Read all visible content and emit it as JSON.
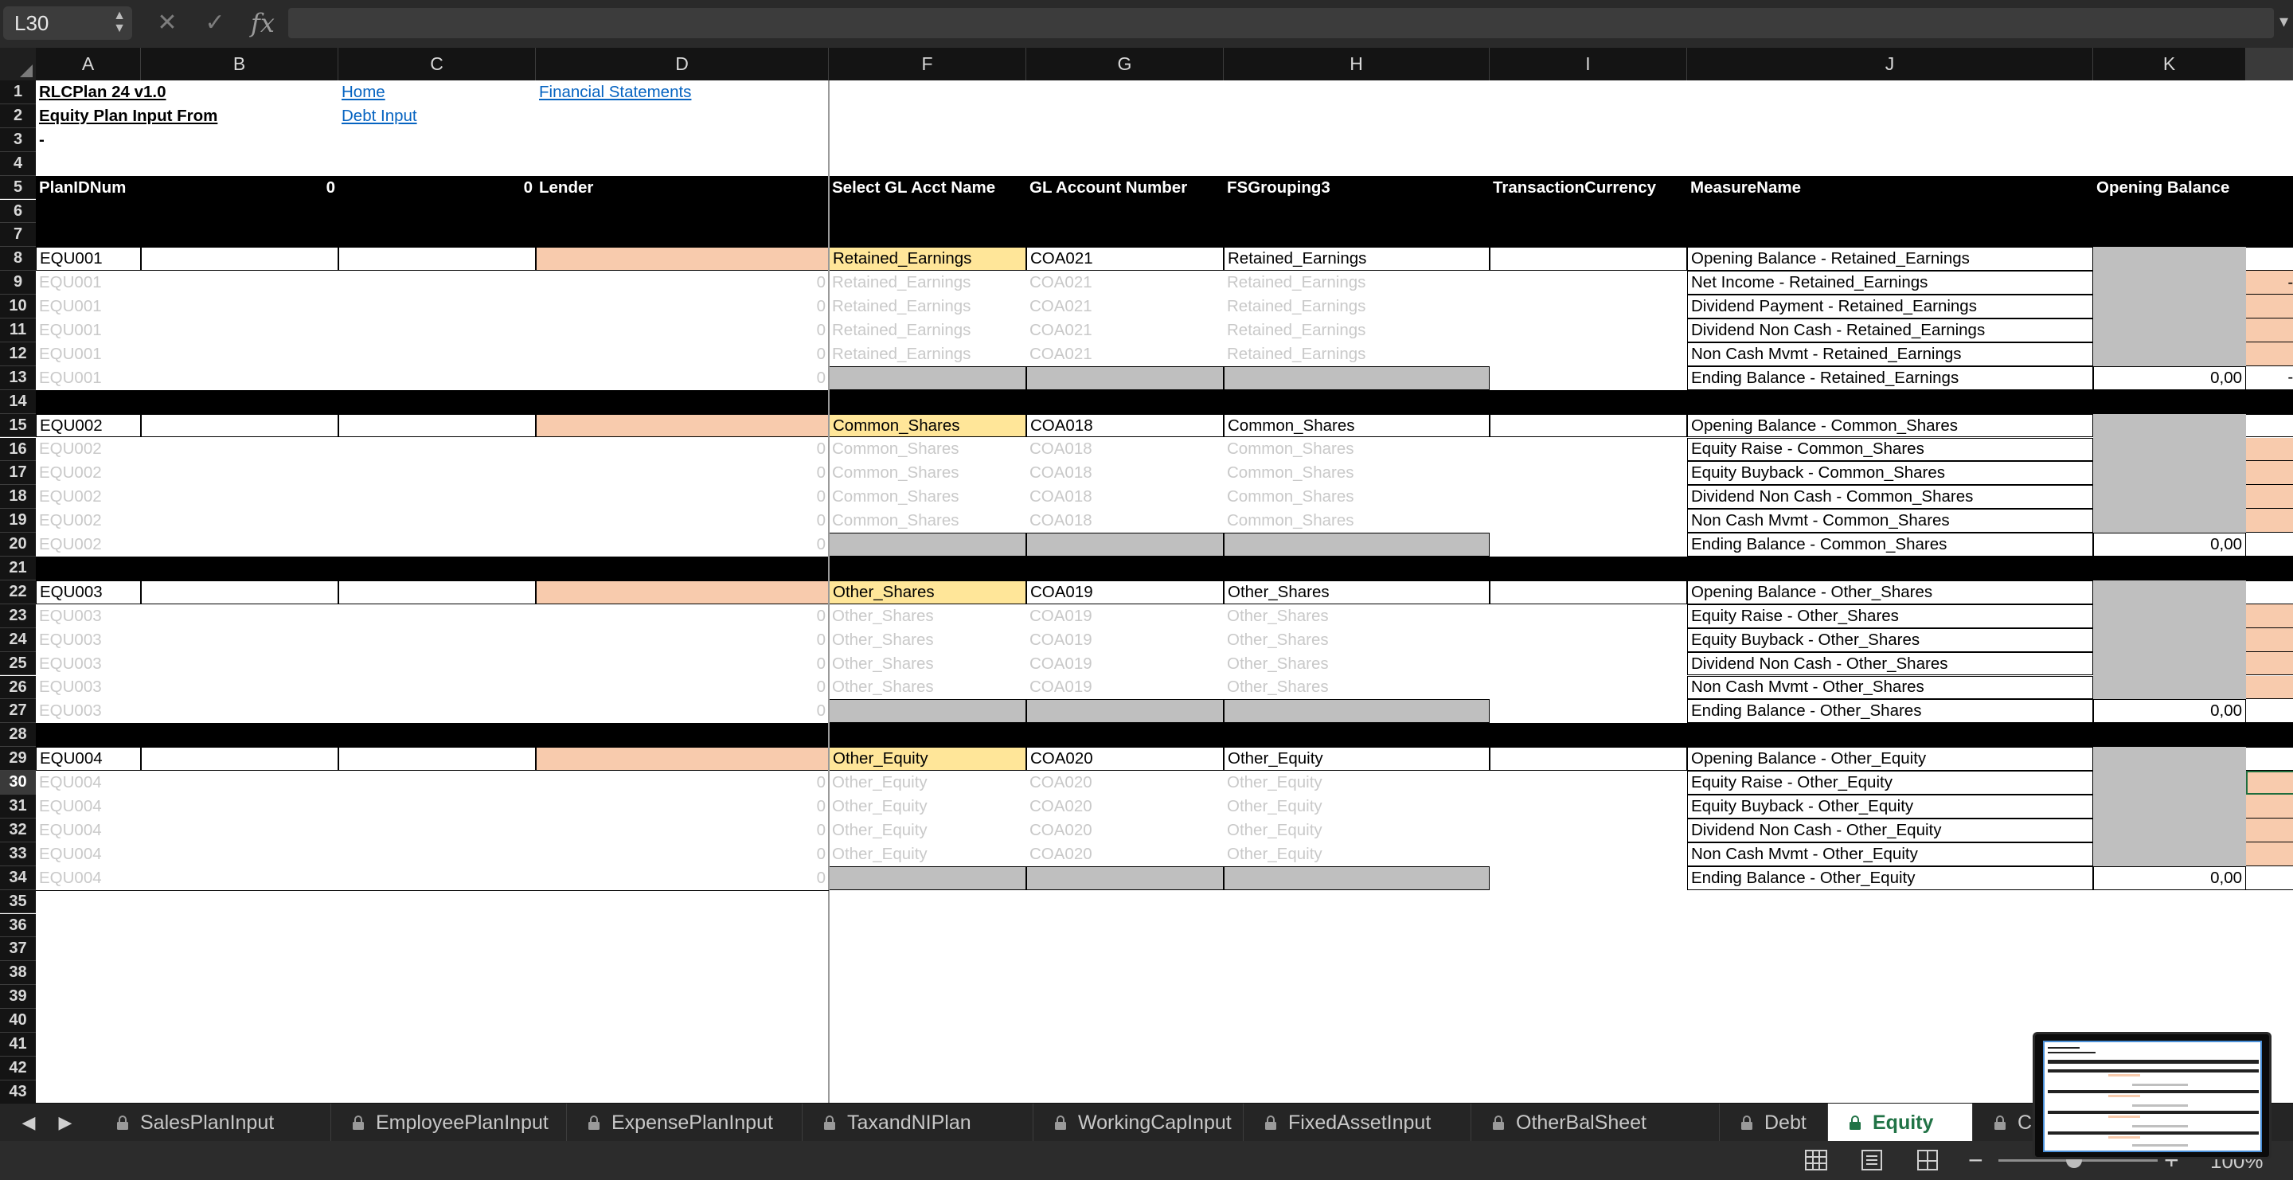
{
  "formula_bar": {
    "name_box": "L30",
    "cancel_icon": "close-icon",
    "enter_icon": "check-icon",
    "fx_label": "fx",
    "formula_value": ""
  },
  "columns": [
    "A",
    "B",
    "C",
    "D",
    "F",
    "G",
    "H",
    "I",
    "J",
    "K"
  ],
  "rows": [
    "1",
    "2",
    "3",
    "4",
    "5",
    "6",
    "7",
    "8",
    "9",
    "10",
    "11",
    "12",
    "13",
    "14",
    "15",
    "16",
    "17",
    "18",
    "19",
    "20",
    "21",
    "22",
    "23",
    "24",
    "25",
    "26",
    "27",
    "28",
    "29",
    "30",
    "31",
    "32",
    "33",
    "34",
    "35",
    "36",
    "37",
    "38",
    "39",
    "40",
    "41",
    "42",
    "43"
  ],
  "selected_cell": "L30",
  "top": {
    "title": "RLCPlan 24 v1.0",
    "subtitle": "Equity Plan Input From",
    "dash": "-",
    "link_home": "Home",
    "link_financials": "Financial Statements",
    "link_debt": "Debt Input"
  },
  "header_row": {
    "plan_id": "PlanIDNum",
    "b_value": "0",
    "c_value": "0",
    "lender": "Lender",
    "gl_name": "Select GL Acct Name",
    "gl_number": "GL Account Number",
    "fs_grouping": "FSGrouping3",
    "currency": "TransactionCurrency",
    "measure": "MeasureName",
    "opening": "Opening Balance"
  },
  "blocks": [
    {
      "id": "EQU001",
      "gl_name": "Retained_Earnings",
      "gl_number": "COA021",
      "fs_group": "Retained_Earnings",
      "ghost_value": "0",
      "measures": [
        "Opening Balance - Retained_Earnings",
        "Net Income - Retained_Earnings",
        "Dividend Payment - Retained_Earnings",
        "Dividend Non Cash - Retained_Earnings",
        "Non Cash Mvmt - Retained_Earnings",
        "Ending Balance - Retained_Earnings"
      ],
      "ending_value": "0,00",
      "l_partial": [
        "",
        "-(",
        "",
        "",
        "",
        "-("
      ]
    },
    {
      "id": "EQU002",
      "gl_name": "Common_Shares",
      "gl_number": "COA018",
      "fs_group": "Common_Shares",
      "ghost_value": "0",
      "measures": [
        "Opening Balance - Common_Shares",
        "Equity Raise - Common_Shares",
        "Equity Buyback - Common_Shares",
        "Dividend Non Cash - Common_Shares",
        "Non Cash Mvmt - Common_Shares",
        "Ending Balance - Common_Shares"
      ],
      "ending_value": "0,00",
      "l_partial": [
        "",
        "",
        "",
        "",
        "",
        ""
      ]
    },
    {
      "id": "EQU003",
      "gl_name": "Other_Shares",
      "gl_number": "COA019",
      "fs_group": "Other_Shares",
      "ghost_value": "0",
      "measures": [
        "Opening Balance - Other_Shares",
        "Equity Raise - Other_Shares",
        "Equity Buyback - Other_Shares",
        "Dividend Non Cash - Other_Shares",
        "Non Cash Mvmt - Other_Shares",
        "Ending Balance - Other_Shares"
      ],
      "ending_value": "0,00",
      "l_partial": [
        "",
        "",
        "",
        "",
        "",
        ""
      ]
    },
    {
      "id": "EQU004",
      "gl_name": "Other_Equity",
      "gl_number": "COA020",
      "fs_group": "Other_Equity",
      "ghost_value": "0",
      "measures": [
        "Opening Balance - Other_Equity",
        "Equity Raise - Other_Equity",
        "Equity Buyback - Other_Equity",
        "Dividend Non Cash - Other_Equity",
        "Non Cash Mvmt - Other_Equity",
        "Ending Balance - Other_Equity"
      ],
      "ending_value": "0,00",
      "l_partial": [
        "",
        "",
        "",
        "",
        "",
        ""
      ]
    }
  ],
  "tabs": [
    "SalesPlanInput",
    "EmployeePlanInput",
    "ExpensePlanInput",
    "TaxandNIPlan",
    "WorkingCapInput",
    "FixedAssetInput",
    "OtherBalSheet",
    "Debt",
    "Equity",
    "C"
  ],
  "active_tab": "Equity",
  "tab_icons": {
    "lock": "lock-icon",
    "prev": "chevron-left-icon",
    "next": "chevron-right-icon"
  },
  "status_bar": {
    "views": [
      "normal-view-icon",
      "page-layout-icon",
      "page-break-icon"
    ],
    "zoom_minus": "−",
    "zoom_plus": "+",
    "zoom_level": "100%"
  },
  "colors": {
    "input_orange": "#f8cbad",
    "gl_yellow": "#ffe699",
    "calc_grey": "#bfbfbf",
    "link_blue": "#0563c1",
    "active_tab_green": "#217346"
  }
}
